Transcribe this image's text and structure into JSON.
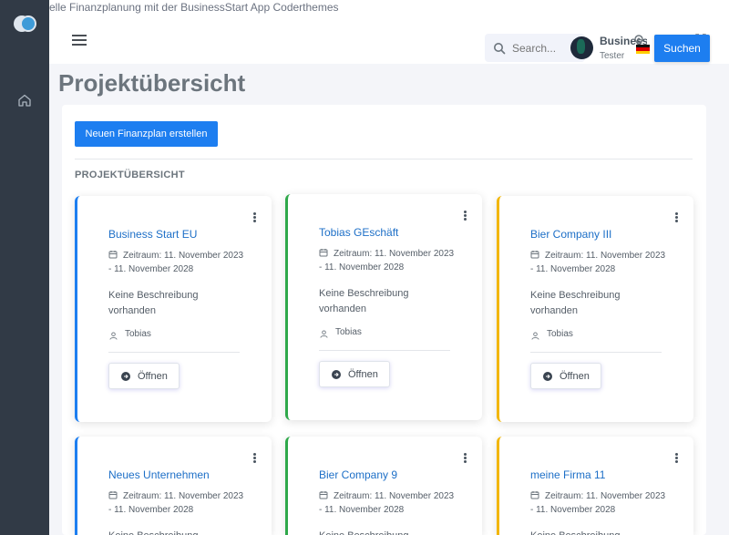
{
  "window": {
    "title": "elle Finanzplanung mit der BusinessStart App Coderthemes"
  },
  "topbar": {
    "search_placeholder": "Search...",
    "user_name": "BusinessSt",
    "user_role": "Tester",
    "search_button": "Suchen"
  },
  "page": {
    "title": "Projektübersicht",
    "new_button": "Neuen Finanzplan erstellen",
    "section_label": "PROJEKTÜBERSICHT"
  },
  "colors": {
    "primary": "#1d7ef0",
    "sidebar": "#313a46",
    "green": "#2ea84a",
    "yellow": "#f2b600"
  },
  "projects": [
    {
      "name": "Business Start EU",
      "period": "Zeitraum: 11. November 2023 - 11. November 2028",
      "description": "Keine Beschreibung vorhanden",
      "owner": "Tobias",
      "open_label": "Öffnen",
      "accent": "blue"
    },
    {
      "name": "Tobias GEschäft",
      "period": "Zeitraum: 11. November 2023 - 11. November 2028",
      "description": "Keine Beschreibung vorhanden",
      "owner": "Tobias",
      "open_label": "Öffnen",
      "accent": "green"
    },
    {
      "name": "Bier Company III",
      "period": "Zeitraum: 11. November 2023 - 11. November 2028",
      "description": "Keine Beschreibung vorhanden",
      "owner": "Tobias",
      "open_label": "Öffnen",
      "accent": "yellow"
    },
    {
      "name": "Neues Unternehmen",
      "period": "Zeitraum: 11. November 2023 - 11. November 2028",
      "description": "Keine Beschreibung",
      "owner": "",
      "open_label": "",
      "accent": "blue"
    },
    {
      "name": "Bier Company 9",
      "period": "Zeitraum: 11. November 2023 - 11. November 2028",
      "description": "Keine Beschreibung",
      "owner": "",
      "open_label": "",
      "accent": "green"
    },
    {
      "name": "meine Firma 11",
      "period": "Zeitraum: 11. November 2023 - 11. November 2028",
      "description": "Keine Beschreibung",
      "owner": "",
      "open_label": "",
      "accent": "yellow"
    }
  ]
}
